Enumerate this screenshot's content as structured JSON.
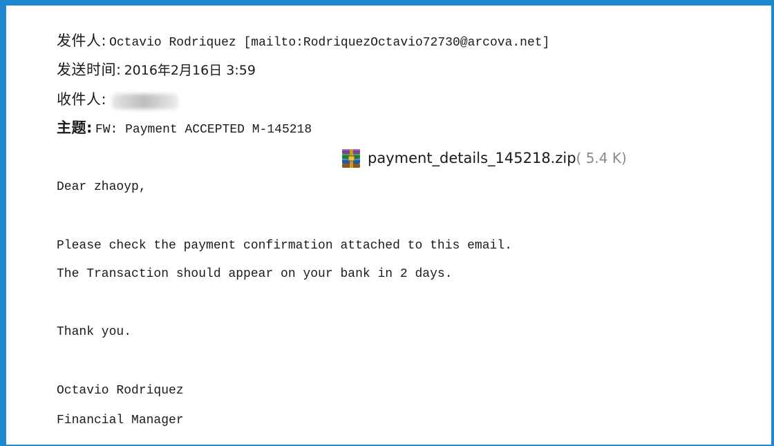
{
  "header": {
    "from_label": "发件人:",
    "from_value": "Octavio Rodriquez [mailto:RodriquezOctavio72730@arcova.net]",
    "sent_label": "发送时间:",
    "sent_value": "2016年2月16日 3:59",
    "to_label": "收件人:",
    "subject_label": "主题:",
    "subject_value": "FW: Payment ACCEPTED M-145218"
  },
  "attachment": {
    "icon": "winrar-archive-icon",
    "name": "payment_details_145218.zip",
    "size": "( 5.4 K)"
  },
  "body": {
    "greeting": "Dear zhaoyp,",
    "line1": "Please check the payment confirmation attached to this email.",
    "line2": "The Transaction should appear on your bank in 2 days.",
    "closing": "Thank you.",
    "signature_name": "Octavio Rodriquez",
    "signature_title": "Financial Manager"
  },
  "colors": {
    "frame": "#1e88d0",
    "text": "#1a1a1a",
    "size_text": "#8a8a8a"
  }
}
